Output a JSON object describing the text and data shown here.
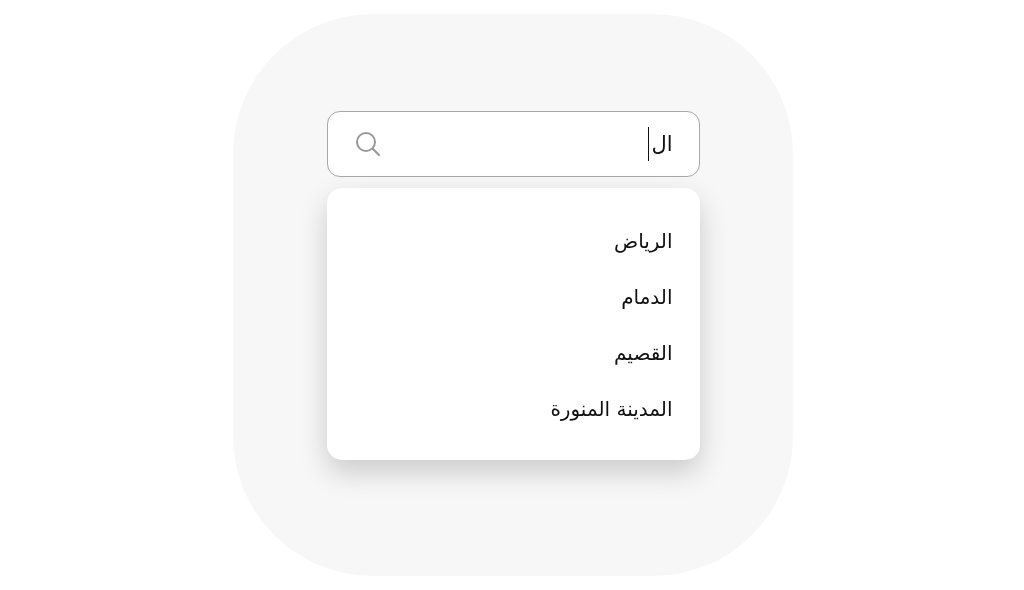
{
  "search": {
    "value": "ال",
    "focused": true
  },
  "suggestions": [
    {
      "label": "الرياض"
    },
    {
      "label": "الدمام"
    },
    {
      "label": "القصيم"
    },
    {
      "label": "المدينة المنورة"
    }
  ]
}
